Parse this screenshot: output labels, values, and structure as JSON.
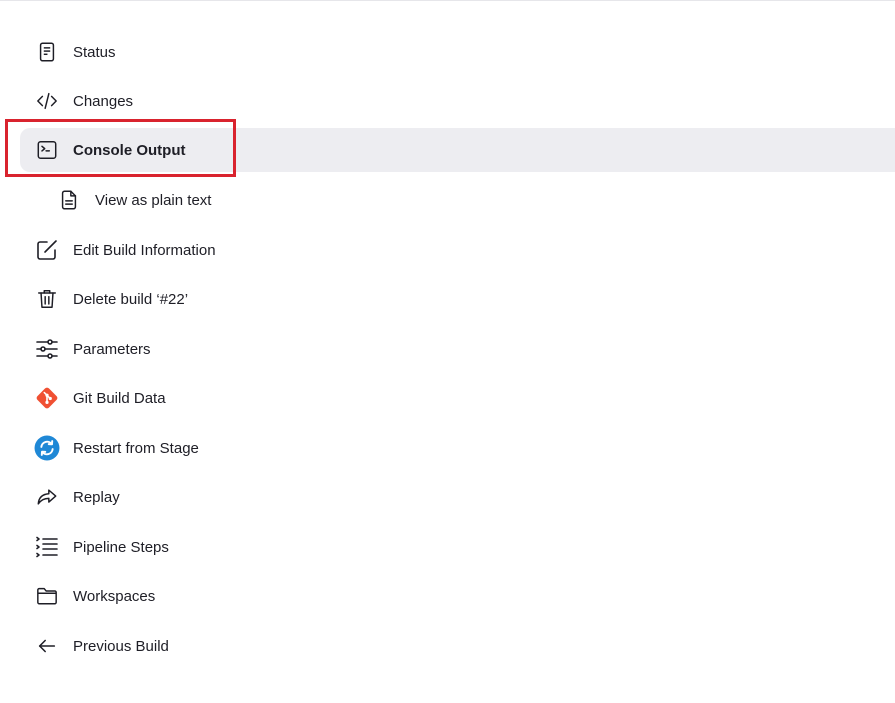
{
  "sidebar": {
    "items": [
      {
        "label": "Status",
        "icon": "document-icon"
      },
      {
        "label": "Changes",
        "icon": "code-icon"
      },
      {
        "label": "Console Output",
        "icon": "terminal-icon",
        "active": true
      },
      {
        "label": "View as plain text",
        "icon": "file-text-icon",
        "sub": true
      },
      {
        "label": "Edit Build Information",
        "icon": "edit-icon"
      },
      {
        "label": "Delete build ‘#22’",
        "icon": "trash-icon"
      },
      {
        "label": "Parameters",
        "icon": "sliders-icon"
      },
      {
        "label": "Git Build Data",
        "icon": "git-icon"
      },
      {
        "label": "Restart from Stage",
        "icon": "restart-icon"
      },
      {
        "label": "Replay",
        "icon": "replay-icon"
      },
      {
        "label": "Pipeline Steps",
        "icon": "list-steps-icon"
      },
      {
        "label": "Workspaces",
        "icon": "folder-icon"
      },
      {
        "label": "Previous Build",
        "icon": "arrow-left-icon"
      }
    ]
  },
  "colors": {
    "active_bg": "#ededf1",
    "highlight": "#d9232e",
    "git": "#f05033",
    "restart": "#1f88d6"
  }
}
